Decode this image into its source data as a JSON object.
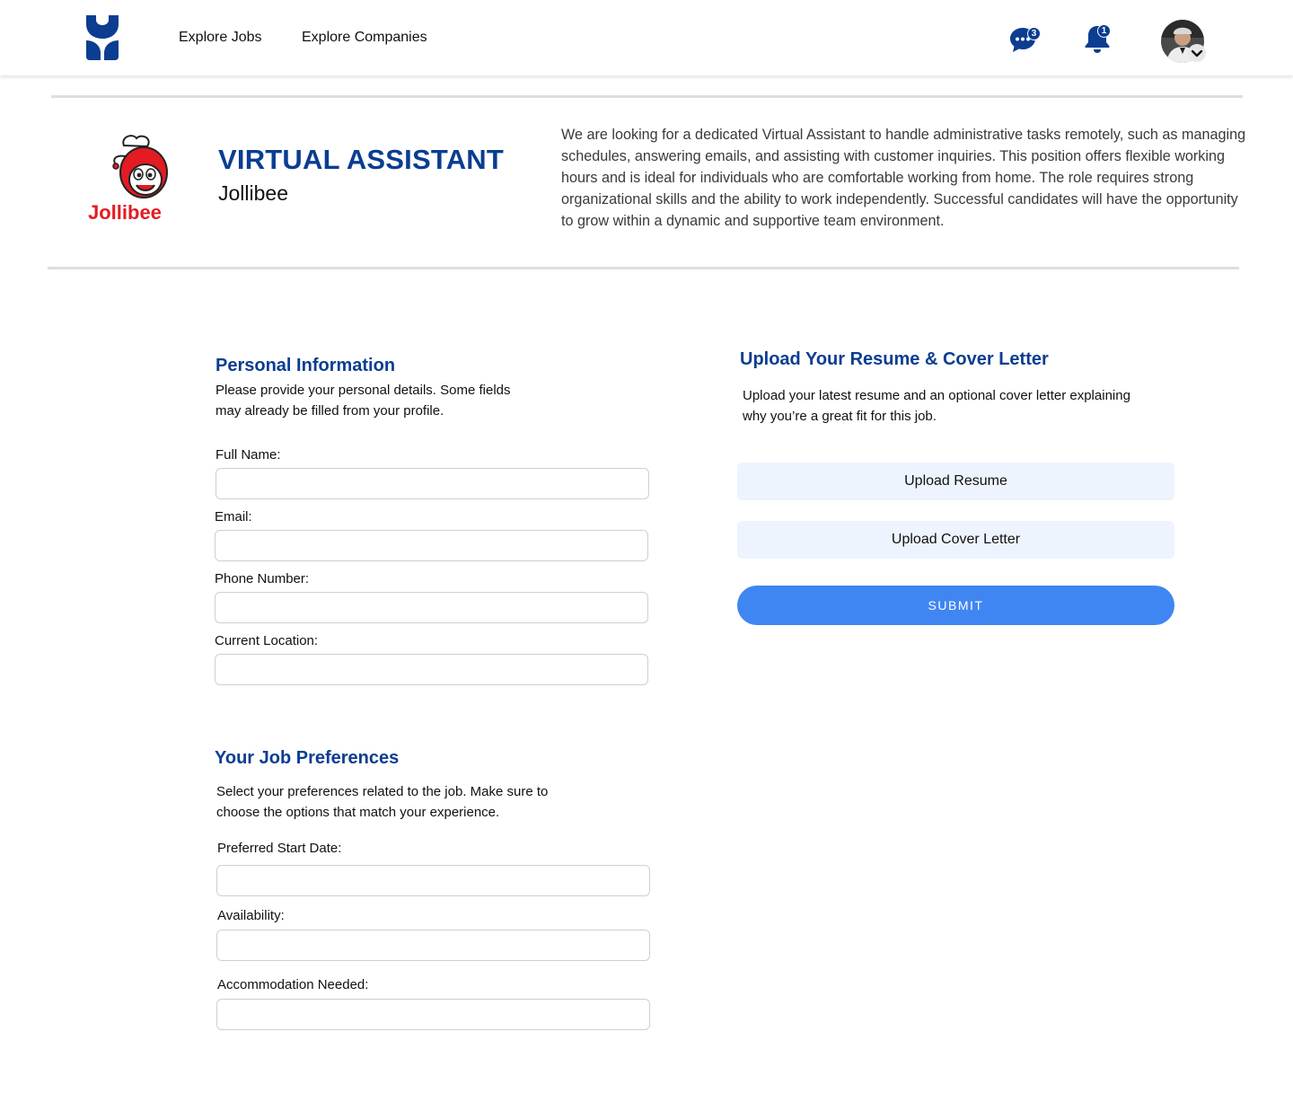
{
  "nav": {
    "links": [
      "Explore Jobs",
      "Explore Companies"
    ],
    "message_count": "3",
    "notification_count": "1"
  },
  "job": {
    "title": "VIRTUAL ASSISTANT",
    "company": "Jollibee",
    "company_logo_text": "Jollibee",
    "description": "We are looking for a dedicated Virtual Assistant to handle administrative tasks remotely, such as managing schedules, answering emails, and assisting with customer inquiries. This position offers flexible working hours and is ideal for individuals who are comfortable working from home. The role requires strong organizational skills and the ability to work independently. Successful candidates will have the opportunity to grow within a dynamic and supportive team environment."
  },
  "personal": {
    "title": "Personal Information",
    "description_line1": "Please provide your personal details. Some fields",
    "description_line2": "may already be filled from your profile.",
    "fields": [
      "Full Name:",
      "Email:",
      "Phone Number:",
      "Current Location:"
    ]
  },
  "preferences": {
    "title": "Your Job Preferences",
    "description_line1": "Select your preferences related to the job. Make sure to",
    "description_line2": "choose the options that match your experience.",
    "fields": [
      "Preferred Start Date:",
      "Availability:",
      "Accommodation Needed:"
    ]
  },
  "upload": {
    "title": "Upload Your Resume & Cover Letter",
    "description_line1": "Upload your latest resume and an optional cover letter explaining",
    "description_line2": "why you’re a great fit for this job.",
    "resume_label": "Upload Resume",
    "cover_label": "Upload Cover Letter",
    "submit_label": "SUBMIT"
  },
  "colors": {
    "brand_navy": "#0b3d91",
    "accent_blue": "#3f86f2",
    "upload_bg": "#eef4fd",
    "jollibee_red": "#e31b23"
  }
}
